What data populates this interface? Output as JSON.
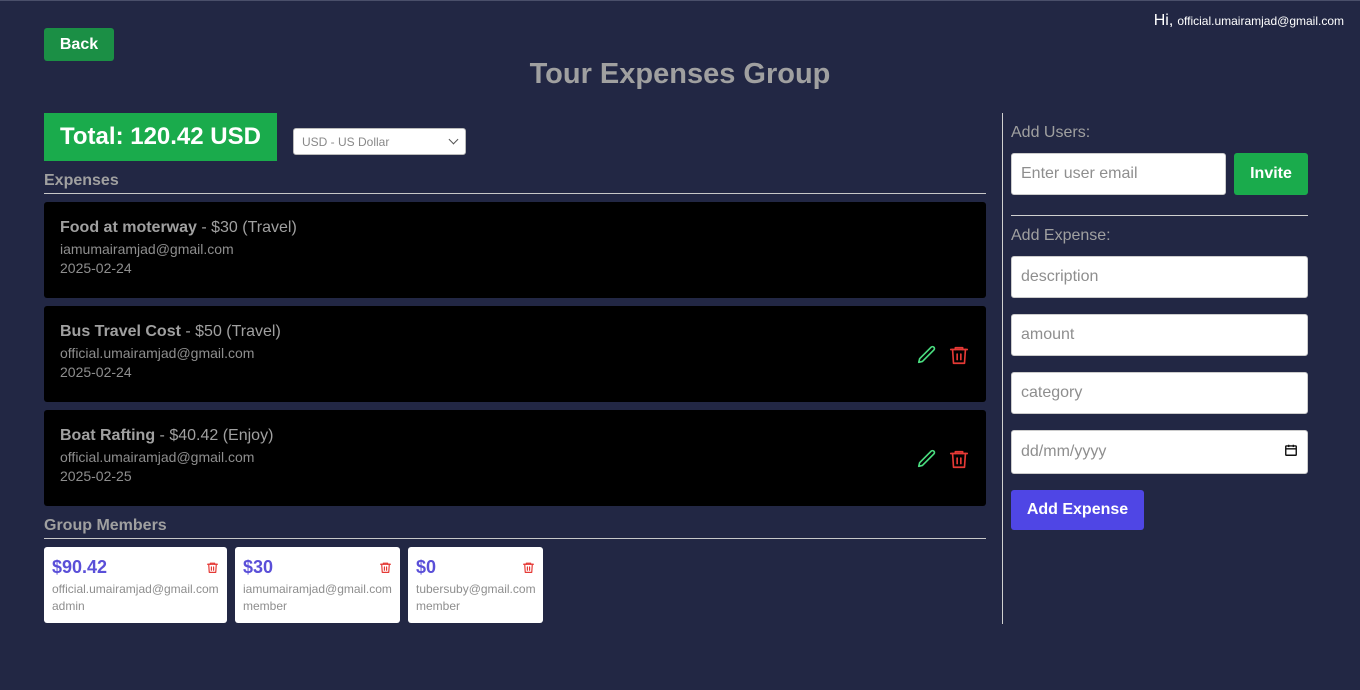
{
  "header": {
    "greeting": "Hi,",
    "user_email": "official.umairamjad@gmail.com",
    "back_label": "Back",
    "title": "Tour Expenses Group"
  },
  "summary": {
    "total_text": "Total: 120.42 USD",
    "currency_selected": "USD - US Dollar"
  },
  "expenses": {
    "heading": "Expenses",
    "items": [
      {
        "name": "Food at moterway",
        "detail": " - $30 (Travel)",
        "email": "iamumairamjad@gmail.com",
        "date": "2025-02-24"
      },
      {
        "name": "Bus Travel Cost",
        "detail": " - $50 (Travel)",
        "email": "official.umairamjad@gmail.com",
        "date": "2025-02-24"
      },
      {
        "name": "Boat Rafting",
        "detail": " - $40.42 (Enjoy)",
        "email": "official.umairamjad@gmail.com",
        "date": "2025-02-25"
      }
    ]
  },
  "members": {
    "heading": "Group Members",
    "items": [
      {
        "amount": "$90.42",
        "email": "official.umairamjad@gmail.com",
        "role": "admin"
      },
      {
        "amount": "$30",
        "email": "iamumairamjad@gmail.com",
        "role": "member"
      },
      {
        "amount": "$0",
        "email": "tubersuby@gmail.com",
        "role": "member"
      }
    ]
  },
  "sidebar": {
    "add_users_label": "Add Users:",
    "user_email_placeholder": "Enter user email",
    "invite_label": "Invite",
    "add_expense_label": "Add Expense:",
    "description_placeholder": "description",
    "amount_placeholder": "amount",
    "category_placeholder": "category",
    "date_placeholder": "dd/mm/yyyy",
    "add_expense_button": "Add Expense"
  },
  "colors": {
    "background": "#222744",
    "accent_green": "#1aab4c",
    "accent_purple": "#4f46e5",
    "delete_red": "#e53935",
    "edit_green": "#4ade80"
  }
}
